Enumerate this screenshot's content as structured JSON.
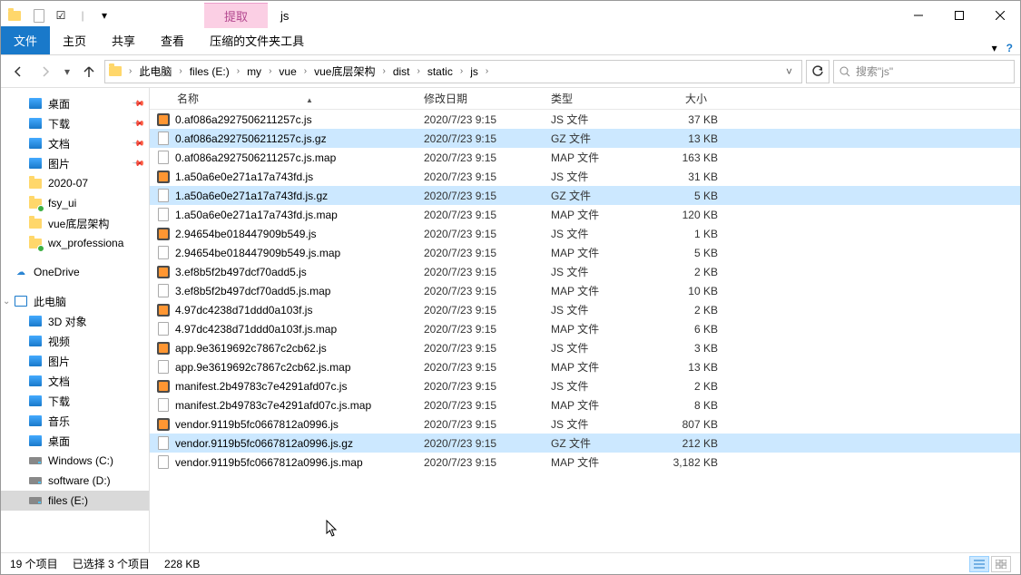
{
  "window": {
    "title": "js",
    "context_tab": "提取"
  },
  "ribbon": {
    "file": "文件",
    "tabs": [
      "主页",
      "共享",
      "查看",
      "压缩的文件夹工具"
    ],
    "caret": "▾"
  },
  "nav": {
    "breadcrumb": [
      "此电脑",
      "files (E:)",
      "my",
      "vue",
      "vue底层架构",
      "dist",
      "static",
      "js"
    ],
    "search_placeholder": "搜索\"js\""
  },
  "sidebar": {
    "quick": [
      {
        "label": "桌面",
        "icon": "blue",
        "pinned": true
      },
      {
        "label": "下载",
        "icon": "blue",
        "pinned": true
      },
      {
        "label": "文档",
        "icon": "blue",
        "pinned": true
      },
      {
        "label": "图片",
        "icon": "blue",
        "pinned": true
      },
      {
        "label": "2020-07",
        "icon": "folder"
      },
      {
        "label": "fsy_ui",
        "icon": "folder",
        "badge": true
      },
      {
        "label": "vue底层架构",
        "icon": "folder"
      },
      {
        "label": "wx_professiona",
        "icon": "folder",
        "badge": true
      }
    ],
    "onedrive": "OneDrive",
    "thispc_label": "此电脑",
    "thispc": [
      {
        "label": "3D 对象",
        "icon": "blue"
      },
      {
        "label": "视频",
        "icon": "blue"
      },
      {
        "label": "图片",
        "icon": "blue"
      },
      {
        "label": "文档",
        "icon": "blue"
      },
      {
        "label": "下载",
        "icon": "blue"
      },
      {
        "label": "音乐",
        "icon": "blue"
      },
      {
        "label": "桌面",
        "icon": "blue"
      },
      {
        "label": "Windows (C:)",
        "icon": "drive"
      },
      {
        "label": "software (D:)",
        "icon": "drive"
      },
      {
        "label": "files (E:)",
        "icon": "drive",
        "selected": true
      }
    ]
  },
  "columns": {
    "name": "名称",
    "date": "修改日期",
    "type": "类型",
    "size": "大小"
  },
  "files": [
    {
      "name": "0.af086a2927506211257c.js",
      "date": "2020/7/23 9:15",
      "type": "JS 文件",
      "size": "37 KB",
      "icon": "js"
    },
    {
      "name": "0.af086a2927506211257c.js.gz",
      "date": "2020/7/23 9:15",
      "type": "GZ 文件",
      "size": "13 KB",
      "icon": "file",
      "selected": true
    },
    {
      "name": "0.af086a2927506211257c.js.map",
      "date": "2020/7/23 9:15",
      "type": "MAP 文件",
      "size": "163 KB",
      "icon": "file"
    },
    {
      "name": "1.a50a6e0e271a17a743fd.js",
      "date": "2020/7/23 9:15",
      "type": "JS 文件",
      "size": "31 KB",
      "icon": "js"
    },
    {
      "name": "1.a50a6e0e271a17a743fd.js.gz",
      "date": "2020/7/23 9:15",
      "type": "GZ 文件",
      "size": "5 KB",
      "icon": "file",
      "selected": true
    },
    {
      "name": "1.a50a6e0e271a17a743fd.js.map",
      "date": "2020/7/23 9:15",
      "type": "MAP 文件",
      "size": "120 KB",
      "icon": "file"
    },
    {
      "name": "2.94654be018447909b549.js",
      "date": "2020/7/23 9:15",
      "type": "JS 文件",
      "size": "1 KB",
      "icon": "js"
    },
    {
      "name": "2.94654be018447909b549.js.map",
      "date": "2020/7/23 9:15",
      "type": "MAP 文件",
      "size": "5 KB",
      "icon": "file"
    },
    {
      "name": "3.ef8b5f2b497dcf70add5.js",
      "date": "2020/7/23 9:15",
      "type": "JS 文件",
      "size": "2 KB",
      "icon": "js"
    },
    {
      "name": "3.ef8b5f2b497dcf70add5.js.map",
      "date": "2020/7/23 9:15",
      "type": "MAP 文件",
      "size": "10 KB",
      "icon": "file"
    },
    {
      "name": "4.97dc4238d71ddd0a103f.js",
      "date": "2020/7/23 9:15",
      "type": "JS 文件",
      "size": "2 KB",
      "icon": "js"
    },
    {
      "name": "4.97dc4238d71ddd0a103f.js.map",
      "date": "2020/7/23 9:15",
      "type": "MAP 文件",
      "size": "6 KB",
      "icon": "file"
    },
    {
      "name": "app.9e3619692c7867c2cb62.js",
      "date": "2020/7/23 9:15",
      "type": "JS 文件",
      "size": "3 KB",
      "icon": "js"
    },
    {
      "name": "app.9e3619692c7867c2cb62.js.map",
      "date": "2020/7/23 9:15",
      "type": "MAP 文件",
      "size": "13 KB",
      "icon": "file"
    },
    {
      "name": "manifest.2b49783c7e4291afd07c.js",
      "date": "2020/7/23 9:15",
      "type": "JS 文件",
      "size": "2 KB",
      "icon": "js"
    },
    {
      "name": "manifest.2b49783c7e4291afd07c.js.map",
      "date": "2020/7/23 9:15",
      "type": "MAP 文件",
      "size": "8 KB",
      "icon": "file"
    },
    {
      "name": "vendor.9119b5fc0667812a0996.js",
      "date": "2020/7/23 9:15",
      "type": "JS 文件",
      "size": "807 KB",
      "icon": "js"
    },
    {
      "name": "vendor.9119b5fc0667812a0996.js.gz",
      "date": "2020/7/23 9:15",
      "type": "GZ 文件",
      "size": "212 KB",
      "icon": "file",
      "selected": true
    },
    {
      "name": "vendor.9119b5fc0667812a0996.js.map",
      "date": "2020/7/23 9:15",
      "type": "MAP 文件",
      "size": "3,182 KB",
      "icon": "file"
    }
  ],
  "status": {
    "count": "19 个项目",
    "selected": "已选择 3 个项目",
    "size": "228 KB"
  }
}
